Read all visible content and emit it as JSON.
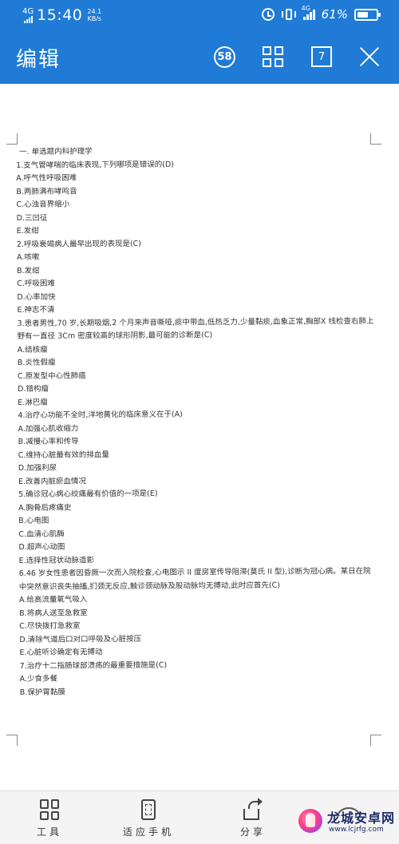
{
  "status_bar": {
    "network": "4G",
    "time": "15:40",
    "speed_value": "24.1",
    "speed_unit": "KB/s",
    "network2": "4G",
    "battery_percent": "61%",
    "battery_level": 0.61
  },
  "header": {
    "title": "编辑",
    "pages_count": "58",
    "current_page": "7"
  },
  "document": {
    "lines": [
      "一.  单选题内科护理学",
      "1.支气管哮喘的临床表现,下列哪项是错误的(D)",
      "A.呼气性呼吸困难",
      "B.两肺满布哮鸣音",
      "C.心浊音界缩小",
      "D.三凹征",
      "E.发绀",
      "2.呼吸衰竭病人最早出现的表现是(C)",
      "A.咳嗽",
      "B.发绀",
      "C.呼吸困难",
      "D.心率加快",
      "E.神志不清",
      "3.患者男性,70 岁,长期吸烟,2 个月来声音嘶哑,痰中带血,低热乏力,少量黏痰,血象正常,胸部X 线检查右肺上野有一直径 3Cm 密度较高的球形阴影,最可能的诊断是(C)",
      "A.结核瘤",
      "B.炎性假瘤",
      "C.原发型中心性肺癌",
      "D.错构瘤",
      "E.淋巴瘤",
      "4.治疗心功能不全时,洋地黄化的临床意义在于(A)",
      "A.加强心肌收缩力",
      "B.减慢心率和传导",
      "C.维持心脏最有效的排血量",
      "D.加强利尿",
      "E.改善内脏瘀血情况",
      "5.确诊冠心病心绞痛最有价值的一项是(E)",
      "A.胸骨后疼痛史",
      "B.心电图",
      "C.血清心肌酶",
      "D.超声心动图",
      "E.选择性冠状动脉造影",
      "6.46 岁女性患者因昏厥一次而入院检查,心电图示 II 度房室传导阻滞(莫氏 II 型),诊断为冠心病。某日在院中突然意识丧失抽搐,扪颈无反应,触诊颈动脉及股动脉均无搏动,此时应首先(C)",
      "A.给高流量氧气吸入",
      "B.将病人送至急救室",
      "C.尽快拨打急救室",
      "D.清除气道后口对口呼吸及心脏按压",
      "E.心脏听诊确定有无搏动",
      "7.治疗十二指肠球部溃疡的最重要措施是(C)",
      "A.少食多餐",
      "B.保护胃黏膜"
    ]
  },
  "toolbar": {
    "tools_label": "工具",
    "fit_label": "适应手机",
    "share_label": "分享"
  },
  "watermark": {
    "name": "龙城安卓网",
    "url": "www.lcjrfg.com"
  },
  "colors": {
    "primary_blue": "#1f7bd6",
    "text": "#333333",
    "toolbar_bg": "#f4f4f4"
  }
}
